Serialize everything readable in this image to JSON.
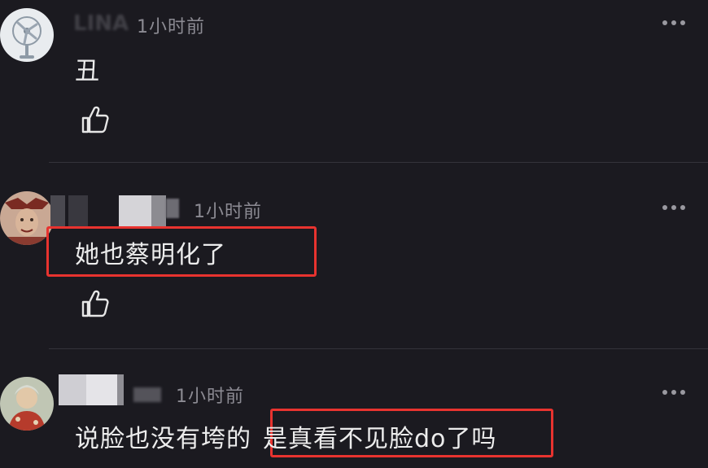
{
  "comments": [
    {
      "username": "LINA",
      "time": "1小时前",
      "text": "丑",
      "more_icon": "more-dots-icon",
      "like_icon": "thumbs-up-icon"
    },
    {
      "username": "",
      "time": "1小时前",
      "text": "她也蔡明化了",
      "more_icon": "more-dots-icon",
      "like_icon": "thumbs-up-icon"
    },
    {
      "username": "",
      "time": "1小时前",
      "text_part1": "说脸也没有垮的",
      "text_part2": "是真看不见脸do了吗",
      "more_icon": "more-dots-icon"
    }
  ],
  "colors": {
    "background": "#1b1a20",
    "highlight": "#e8332f",
    "time": "#8c8b93",
    "text": "#ececec"
  }
}
